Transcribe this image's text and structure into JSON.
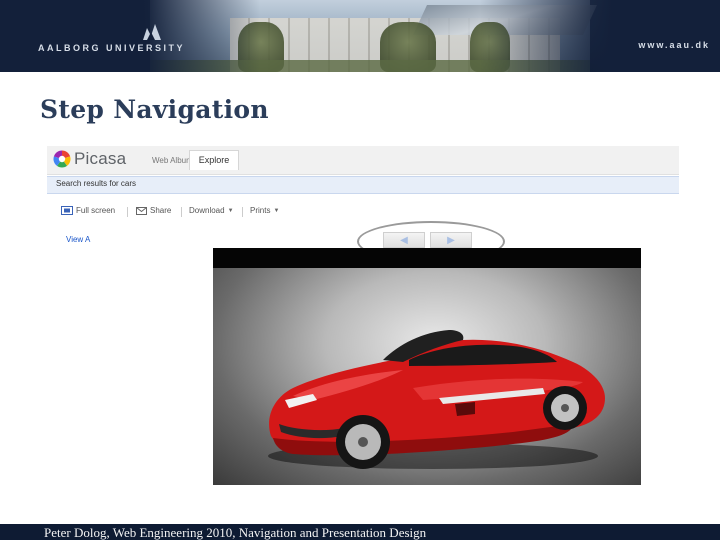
{
  "slide": {
    "university_name": "AALBORG UNIVERSITY",
    "website": "www.aau.dk",
    "title": "Step Navigation",
    "footer": "Peter Dolog, Web Engineering 2010, Navigation and Presentation Design"
  },
  "picasa": {
    "brand": "Picasa",
    "brand_sub": "Web Albums",
    "explore_tab": "Explore",
    "search_results": "Search results for cars",
    "toolbar": {
      "fullscreen": "Full screen",
      "share": "Share",
      "download": "Download",
      "prints": "Prints"
    },
    "photo_link": "View A",
    "nav": {
      "prev_icon": "left-arrow-icon",
      "next_icon": "right-arrow-icon"
    }
  },
  "colors": {
    "title": "#2b3d5a",
    "banner": "#13203a",
    "car_red": "#d41818",
    "nav_arrow": "#a9bfe3",
    "highlight_ellipse": "#9a9a9a"
  }
}
